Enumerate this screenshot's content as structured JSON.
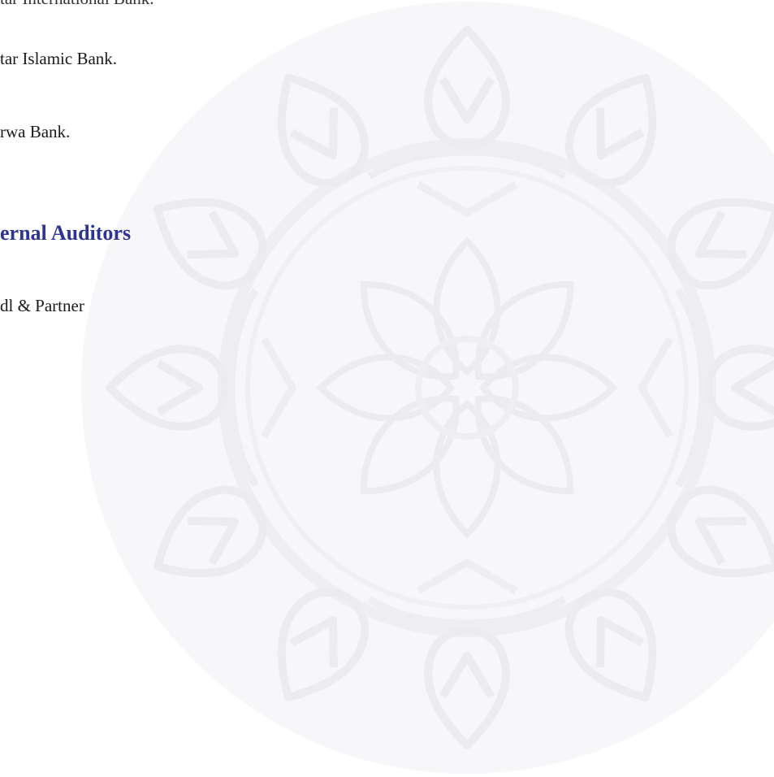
{
  "document": {
    "line_top_partial": "tar International Bank.",
    "line_1": "tar Islamic Bank.",
    "line_2": "rwa Bank.",
    "section_heading": "ernal Auditors",
    "line_3": "dl & Partner"
  },
  "watermark": {
    "icon": "islamic-geometric-rosette",
    "color": "#f5f5f7"
  }
}
